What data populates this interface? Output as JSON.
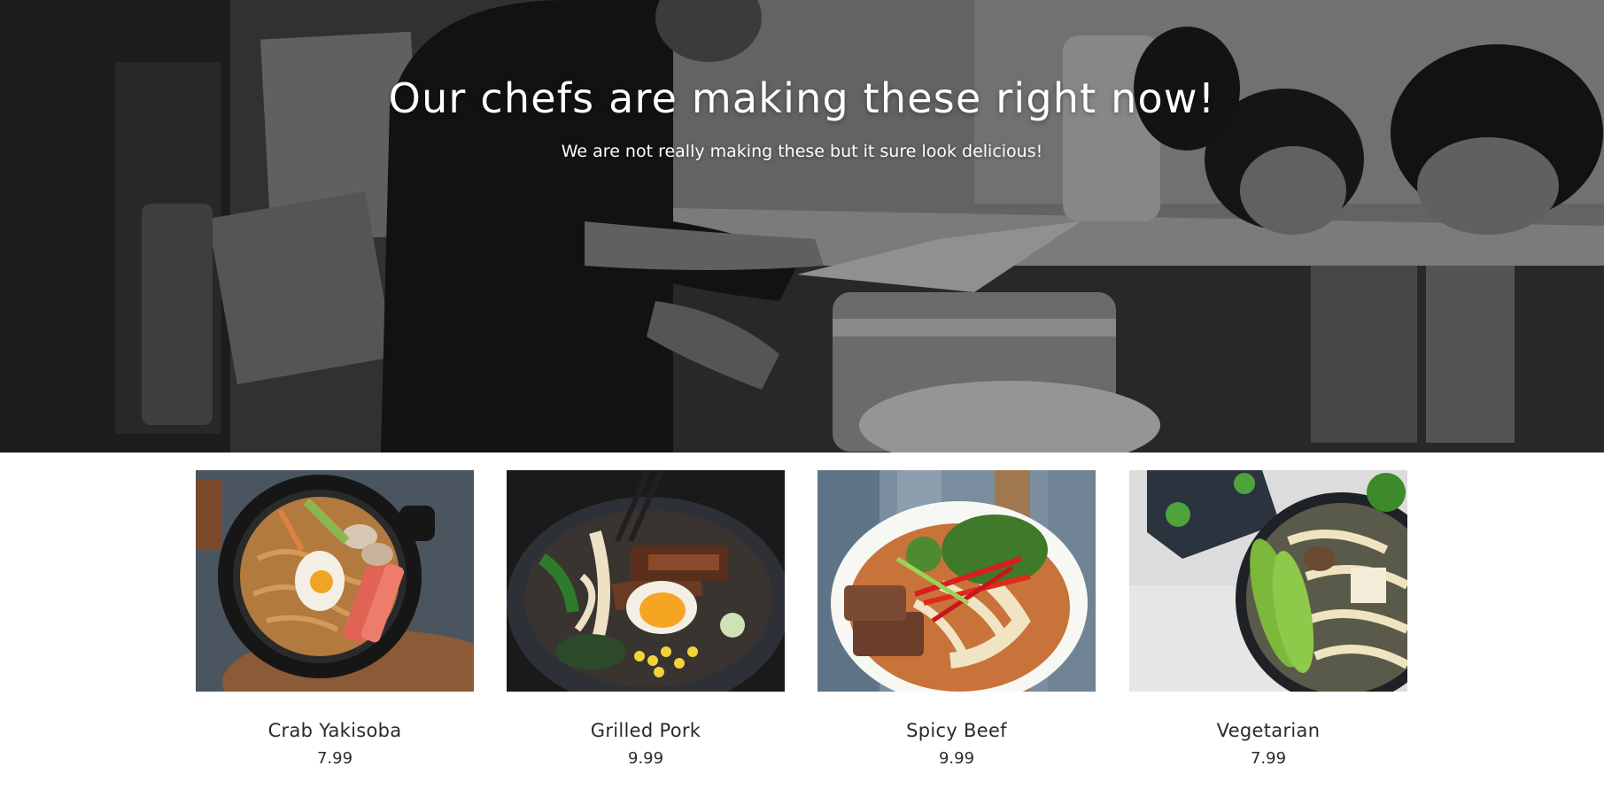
{
  "hero": {
    "title": "Our chefs are making these right now!",
    "subtitle": "We are not really making these but it sure look delicious!"
  },
  "products": [
    {
      "name": "Crab Yakisoba",
      "price": "7.99"
    },
    {
      "name": "Grilled Pork",
      "price": "9.99"
    },
    {
      "name": "Spicy Beef",
      "price": "9.99"
    },
    {
      "name": "Vegetarian",
      "price": "7.99"
    }
  ],
  "colors": {
    "text": "#2a2a2a",
    "hero_text": "#ffffff",
    "background": "#ffffff"
  }
}
